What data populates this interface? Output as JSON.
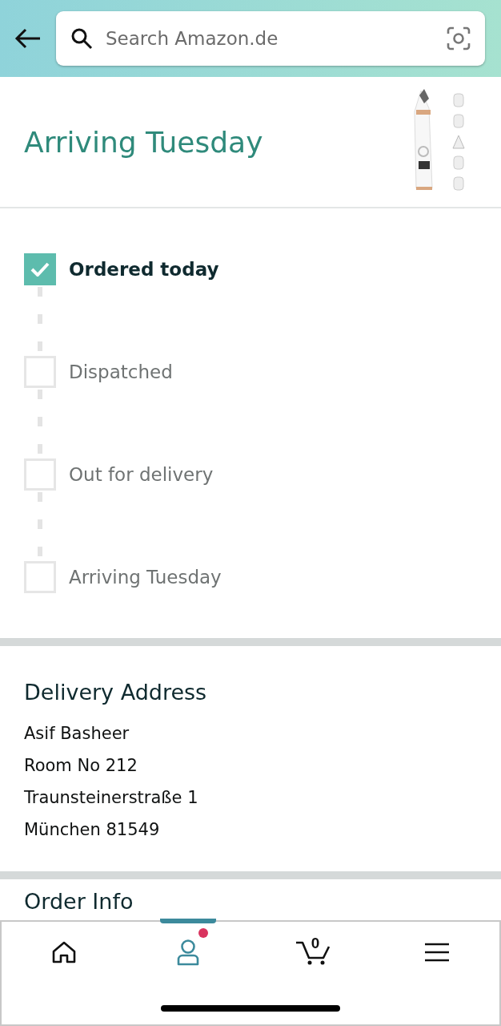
{
  "search": {
    "placeholder": "Search Amazon.de"
  },
  "heading": "Arriving Tuesday",
  "steps": [
    {
      "label": "Ordered today",
      "checked": true
    },
    {
      "label": "Dispatched",
      "checked": false
    },
    {
      "label": "Out for delivery",
      "checked": false
    },
    {
      "label": "Arriving Tuesday",
      "checked": false
    }
  ],
  "delivery_address": {
    "title": "Delivery Address",
    "lines": [
      "Asif Basheer",
      "Room No 212",
      "Traunsteinerstraße 1",
      "München 81549"
    ]
  },
  "order_info": {
    "title": "Order Info"
  },
  "nav": [
    {
      "kind": "home",
      "selected": false
    },
    {
      "kind": "account",
      "selected": true,
      "notification": true
    },
    {
      "kind": "cart",
      "selected": false,
      "count": "0"
    },
    {
      "kind": "menu",
      "selected": false
    }
  ]
}
